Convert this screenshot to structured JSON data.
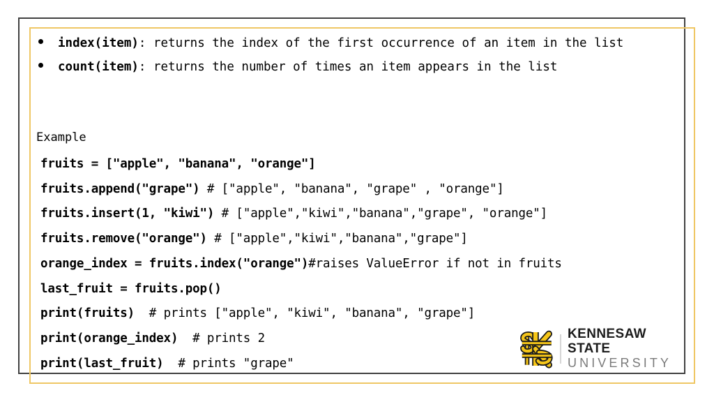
{
  "slide": {
    "background_color": "#FFFFFF",
    "frame_outer_color": "#404040",
    "frame_inner_color": "#EFC764"
  },
  "bullets": [
    {
      "bold_part": "index(item)",
      "rest": ": returns the index of the first occurrence of an item in the list"
    },
    {
      "bold_part": "count(item)",
      "rest": ": returns the number of times an item appears in the list"
    }
  ],
  "example_label": "Example",
  "code_lines": [
    {
      "code": "fruits = [\"apple\", \"banana\", \"orange\"]",
      "comment": ""
    },
    {
      "code": "fruits.append(\"grape\") ",
      "comment": "# [\"apple\", \"banana\", \"grape\" , \"orange\"]"
    },
    {
      "code": "fruits.insert(1, \"kiwi\") ",
      "comment": "# [\"apple\",\"kiwi\",\"banana\",\"grape\", \"orange\"]"
    },
    {
      "code": "fruits.remove(\"orange\") ",
      "comment": "# [\"apple\",\"kiwi\",\"banana\",\"grape\"]"
    },
    {
      "code": "orange_index = fruits.index(\"orange\")",
      "comment": "#raises ValueError if not in fruits"
    },
    {
      "code": "last_fruit = fruits.pop()",
      "comment": ""
    },
    {
      "code": "print(fruits) ",
      "comment": " # prints [\"apple\", \"kiwi\", \"banana\", \"grape\"]"
    },
    {
      "code": "print(orange_index) ",
      "comment": " # prints 2"
    },
    {
      "code": "print(last_fruit) ",
      "comment": " # prints \"grape\""
    }
  ],
  "logo": {
    "mark_name": "ksu-owl-monogram",
    "line1": "KENNESAW STATE",
    "line2": "UNIVERSITY",
    "gold": "#F5C518",
    "outline": "#1A1A1A",
    "text_color": "#1C1C1C",
    "subtext_color": "#7A7A7A"
  }
}
